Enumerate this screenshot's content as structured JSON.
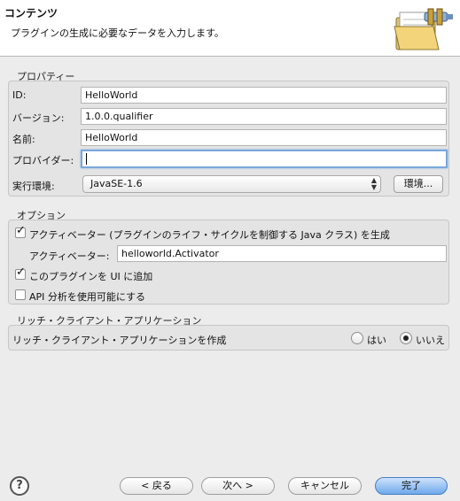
{
  "header": {
    "title": "コンテンツ",
    "description": "プラグインの生成に必要なデータを入力します。"
  },
  "properties": {
    "group_label": "プロパティー",
    "id_label": "ID:",
    "id_value": "HelloWorld",
    "version_label": "バージョン:",
    "version_value": "1.0.0.qualifier",
    "name_label": "名前:",
    "name_value": "HelloWorld",
    "provider_label": "プロバイダー:",
    "provider_value": "",
    "env_label": "実行環境:",
    "env_value": "JavaSE-1.6",
    "env_button": "環境..."
  },
  "options": {
    "group_label": "オプション",
    "activator_check_label": "アクティベーター (プラグインのライフ・サイクルを制御する Java クラス) を生成",
    "activator_check_checked": true,
    "activator_label": "アクティベーター:",
    "activator_value": "helloworld.Activator",
    "ui_check_label": "このプラグインを UI に追加",
    "ui_check_checked": true,
    "api_check_label": "API 分析を使用可能にする",
    "api_check_checked": false
  },
  "rich_client": {
    "group_label": "リッチ・クライアント・アプリケーション",
    "question": "リッチ・クライアント・アプリケーションを作成",
    "yes_label": "はい",
    "no_label": "いいえ",
    "selected": "いいえ"
  },
  "footer": {
    "help_icon": "?",
    "back_button": "< 戻る",
    "next_button": "次へ >",
    "cancel_button": "キャンセル",
    "finish_button": "完了"
  },
  "colors": {
    "accent": "#6ea8ec",
    "focus_ring": "#7aa7db"
  }
}
